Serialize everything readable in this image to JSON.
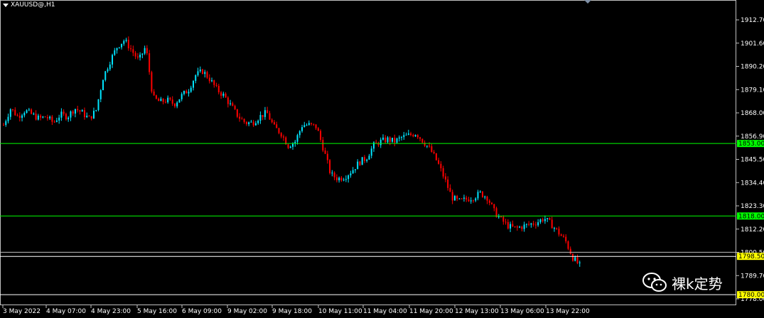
{
  "chart": {
    "title": "XAUUSD@,H1",
    "symbol_menu_icon": "triangle-down-icon",
    "scroll_icon": "chart-shift-triangle-icon"
  },
  "watermark": {
    "icon": "wechat-icon",
    "text": "裸k定势"
  },
  "colors": {
    "background": "#000000",
    "bull": "#00e5ff",
    "bear": "#ff0000",
    "level_green": "#00ff00",
    "level_white": "#ffffff",
    "price_yellow": "#ffff00"
  },
  "chart_data": {
    "type": "candlestick",
    "title": "XAUUSD@,H1",
    "y_ticks": [
      "1912.70",
      "1901.60",
      "1890.20",
      "1879.10",
      "1868.00",
      "1856.90",
      "1845.50",
      "1834.40",
      "1823.30",
      "1812.20",
      "1800.50",
      "1789.70",
      "1778.00"
    ],
    "ylim": [
      1778.0,
      1916.6
    ],
    "x_ticks": [
      "3 May 2022",
      "4 May 07:00",
      "4 May 23:00",
      "5 May 16:00",
      "6 May 09:00",
      "9 May 02:00",
      "9 May 18:00",
      "10 May 11:00",
      "11 May 04:00",
      "11 May 20:00",
      "12 May 13:00",
      "13 May 06:00",
      "13 May 22:00"
    ],
    "levels": [
      {
        "price": 1853.0,
        "label": "1853.00",
        "color": "#00ff00"
      },
      {
        "price": 1818.0,
        "label": "1818.00",
        "color": "#00ff00"
      },
      {
        "price": 1800.5,
        "label": "",
        "color": "#c0c0c0"
      },
      {
        "price": 1798.5,
        "label": "1798.50",
        "color": "#ffffff"
      },
      {
        "price": 1780.0,
        "label": "1780.00",
        "color": "#ffffff"
      }
    ],
    "close_path": [
      1862,
      1870,
      1866,
      1869,
      1867,
      1865,
      1866,
      1863,
      1867,
      1866,
      1870,
      1868,
      1865,
      1869,
      1885,
      1893,
      1900,
      1903,
      1898,
      1893,
      1900,
      1875,
      1873,
      1874,
      1872,
      1876,
      1879,
      1886,
      1888,
      1884,
      1879,
      1876,
      1871,
      1866,
      1863,
      1863,
      1866,
      1868,
      1861,
      1858,
      1852,
      1854,
      1862,
      1862,
      1861,
      1850,
      1838,
      1836,
      1837,
      1840,
      1844,
      1846,
      1852,
      1854,
      1855,
      1854,
      1856,
      1857,
      1858,
      1854,
      1850,
      1844,
      1836,
      1827,
      1825,
      1826,
      1827,
      1829,
      1827,
      1820,
      1816,
      1813,
      1812,
      1813,
      1814,
      1815,
      1817,
      1814,
      1810,
      1806,
      1798,
      1794
    ]
  }
}
